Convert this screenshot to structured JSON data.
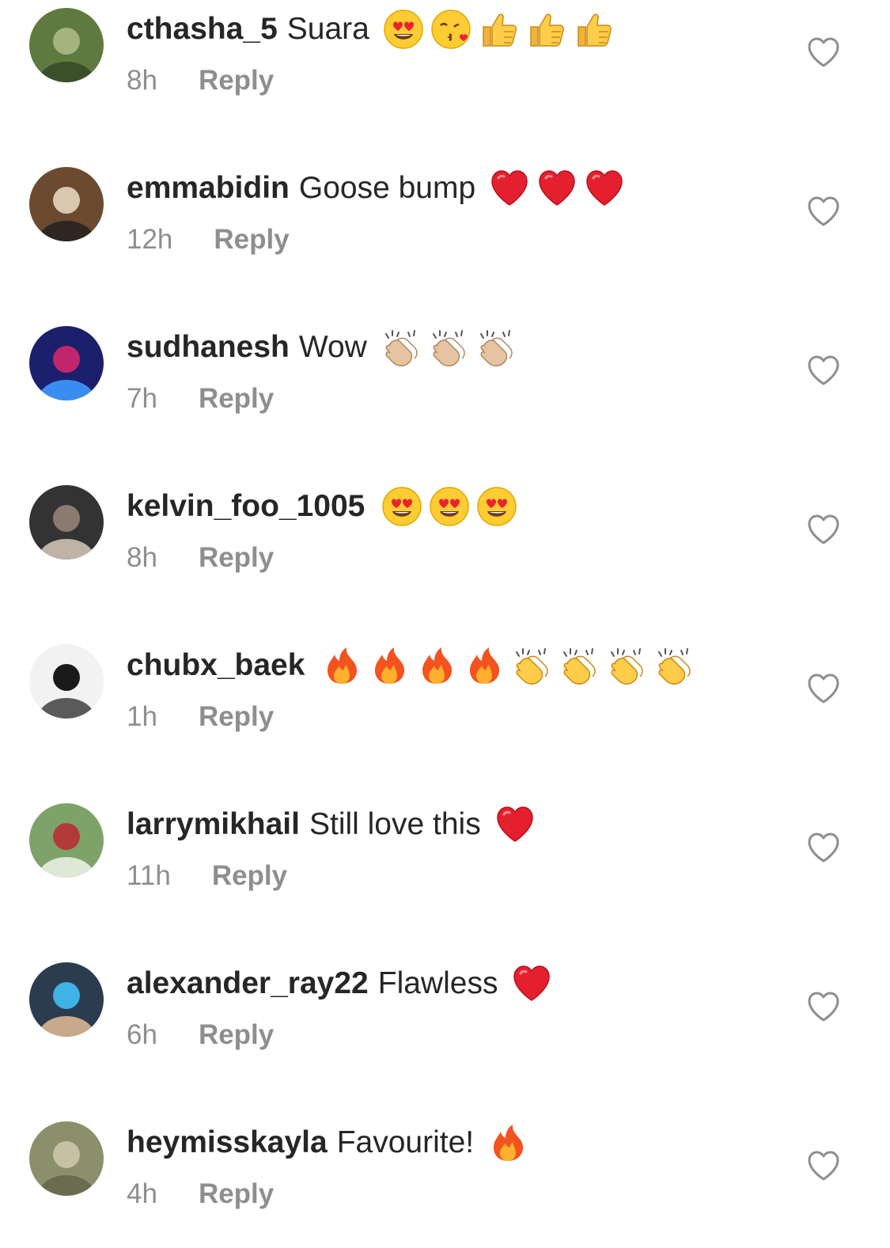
{
  "comments": [
    {
      "username": "cthasha_5",
      "text": "Suara",
      "time": "8h",
      "reply_label": "Reply",
      "emojis": [
        "heart-eyes",
        "kissing-heart",
        "thumbs-up",
        "thumbs-up",
        "thumbs-up"
      ],
      "avatar_colors": [
        "#5f7a3e",
        "#a3b57d",
        "#3b4f2a"
      ]
    },
    {
      "username": "emmabidin",
      "text": "Goose bump",
      "time": "12h",
      "reply_label": "Reply",
      "emojis": [
        "red-heart",
        "red-heart",
        "red-heart"
      ],
      "avatar_colors": [
        "#6b4a2f",
        "#d9c7b0",
        "#2e2620"
      ]
    },
    {
      "username": "sudhanesh",
      "text": "Wow",
      "time": "7h",
      "reply_label": "Reply",
      "emojis": [
        "clapping-hands-light",
        "clapping-hands-light",
        "clapping-hands-light"
      ],
      "avatar_colors": [
        "#1c1f6b",
        "#c1266c",
        "#3a8df0"
      ]
    },
    {
      "username": "kelvin_foo_1005",
      "text": "",
      "time": "8h",
      "reply_label": "Reply",
      "emojis": [
        "heart-eyes",
        "heart-eyes",
        "heart-eyes"
      ],
      "avatar_colors": [
        "#333333",
        "#8a7a70",
        "#bfb3a8"
      ]
    },
    {
      "username": "chubx_baek",
      "text": "",
      "time": "1h",
      "reply_label": "Reply",
      "emojis": [
        "fire",
        "fire",
        "fire",
        "fire",
        "clapping-hands",
        "clapping-hands",
        "clapping-hands",
        "clapping-hands"
      ],
      "avatar_colors": [
        "#f2f2f2",
        "#1a1a1a",
        "#5a5a5a"
      ]
    },
    {
      "username": "larrymikhail",
      "text": "Still love this",
      "time": "11h",
      "reply_label": "Reply",
      "emojis": [
        "red-heart"
      ],
      "avatar_colors": [
        "#7ea36a",
        "#b33a3a",
        "#dfe7d6"
      ]
    },
    {
      "username": "alexander_ray22",
      "text": "Flawless",
      "time": "6h",
      "reply_label": "Reply",
      "emojis": [
        "red-heart"
      ],
      "avatar_colors": [
        "#2b3c4f",
        "#3fb2e6",
        "#c9a98b"
      ]
    },
    {
      "username": "heymisskayla",
      "text": "Favourite!",
      "time": "4h",
      "reply_label": "Reply",
      "emojis": [
        "fire"
      ],
      "avatar_colors": [
        "#8b8f6a",
        "#c4c1a5",
        "#6b6b50"
      ]
    }
  ],
  "like_icon": "heart-outline-icon",
  "colors": {
    "text": "#262626",
    "secondary": "#8e8e8e",
    "background": "#ffffff"
  }
}
